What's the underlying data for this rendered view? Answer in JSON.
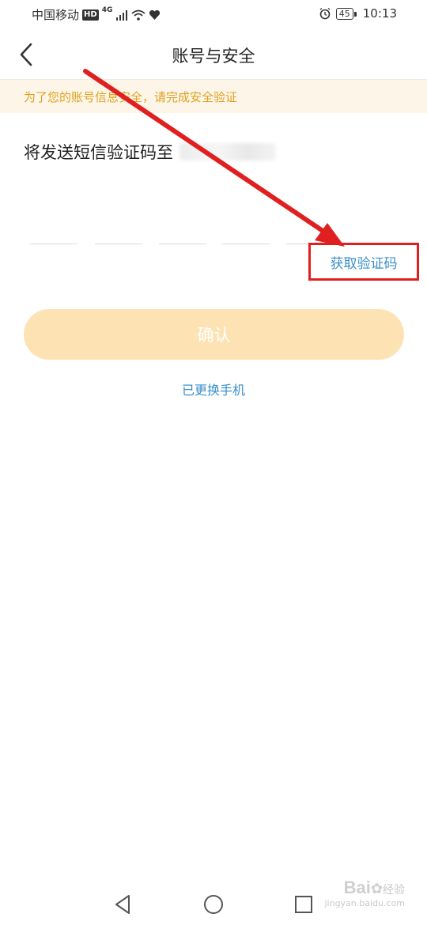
{
  "status_bar": {
    "carrier": "中国移动",
    "hd": "HD",
    "network": "4G",
    "battery": "45",
    "time": "10:13"
  },
  "header": {
    "title": "账号与安全",
    "back_icon": "chevron-left-icon"
  },
  "notice": {
    "text": "为了您的账号信息安全，请完成安全验证"
  },
  "verify": {
    "sms_prefix": "将发送短信验证码至",
    "code_slot_count": 5,
    "get_code_label": "获取验证码",
    "confirm_label": "确认",
    "changed_phone_label": "已更换手机"
  },
  "system_nav": {
    "back_icon": "triangle-back-icon",
    "home_icon": "circle-home-icon",
    "recent_icon": "square-recent-icon"
  },
  "watermark": {
    "brand": "Bai",
    "brand_cn": "经验",
    "sub": "jingyan.baidu.com"
  },
  "colors": {
    "accent_blue": "#3a8fc8",
    "notice_text": "#e0a020",
    "notice_bg": "#fdf6e8",
    "confirm_bg": "#fde3b3",
    "annotation_red": "#e02020"
  }
}
